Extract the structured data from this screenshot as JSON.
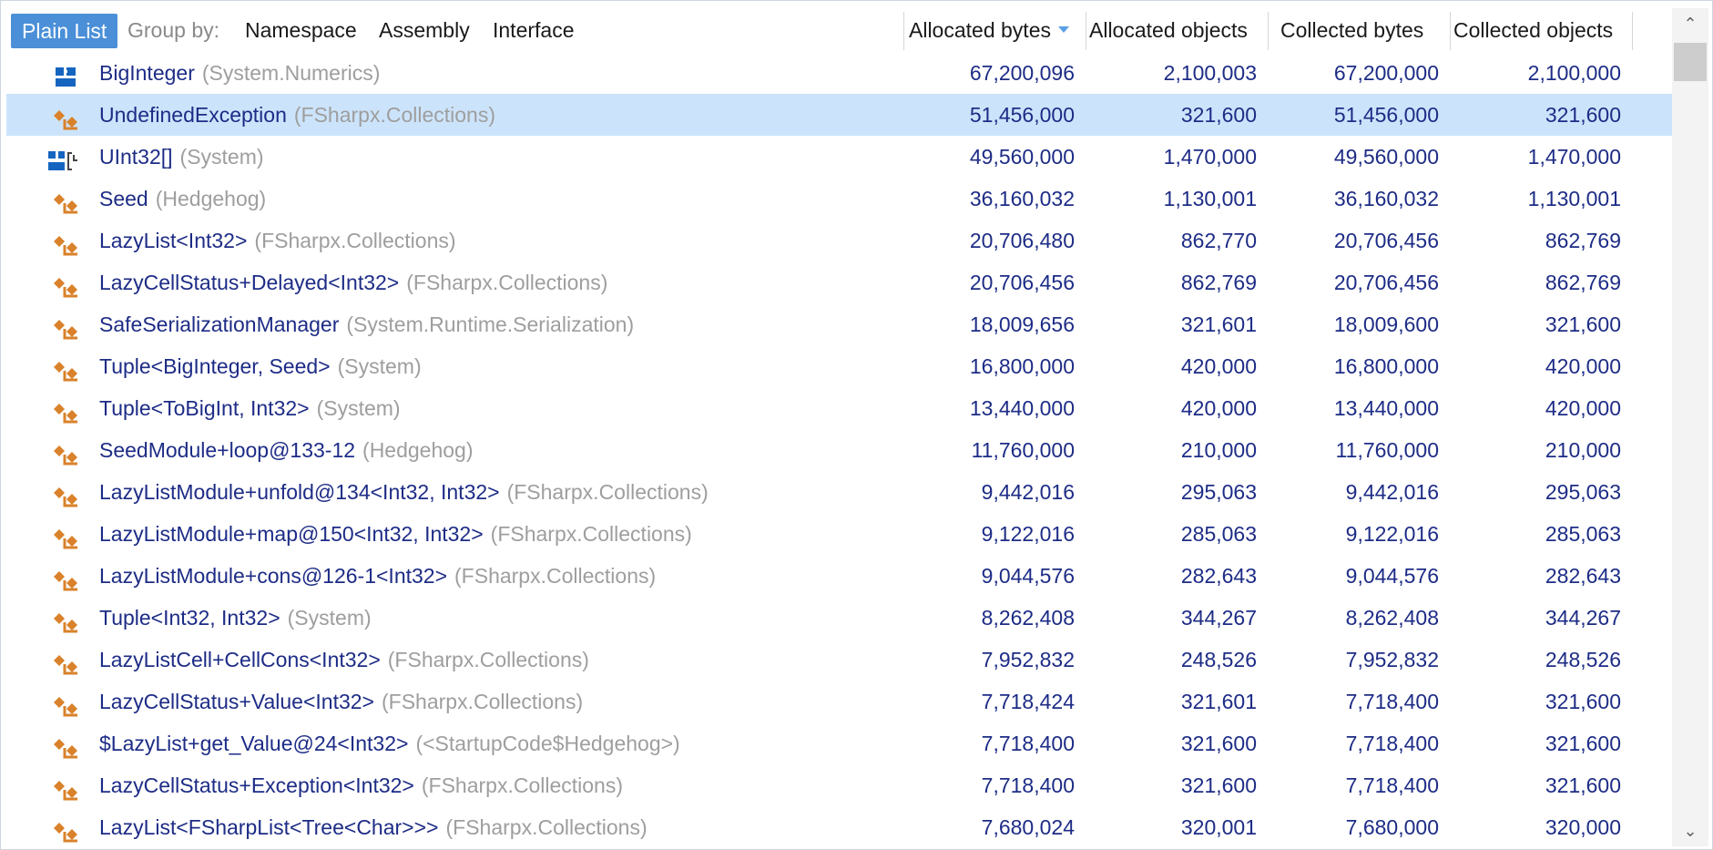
{
  "toolbar": {
    "plain_list": "Plain List",
    "group_by": "Group by:",
    "namespace": "Namespace",
    "assembly": "Assembly",
    "interface": "Interface"
  },
  "columns": {
    "allocated_bytes": "Allocated bytes",
    "allocated_objects": "Allocated objects",
    "collected_bytes": "Collected bytes",
    "collected_objects": "Collected objects"
  },
  "colors": {
    "accent": "#4a8fd8",
    "selection": "#cce4fb",
    "type_text": "#1d2c86",
    "ns_text": "#9e9e9e",
    "class_icon": "#d9822b",
    "struct_icon": "#1565c0"
  },
  "rows": [
    {
      "name": "BigInteger",
      "ns": "(System.Numerics)",
      "icon": "struct-icon",
      "ab": "67,200,096",
      "ao": "2,100,003",
      "cb": "67,200,000",
      "co": "2,100,000"
    },
    {
      "name": "UndefinedException",
      "ns": "(FSharpx.Collections)",
      "icon": "class-icon",
      "ab": "51,456,000",
      "ao": "321,600",
      "cb": "51,456,000",
      "co": "321,600"
    },
    {
      "name": "UInt32[]",
      "ns": "(System)",
      "icon": "array-icon",
      "ab": "49,560,000",
      "ao": "1,470,000",
      "cb": "49,560,000",
      "co": "1,470,000"
    },
    {
      "name": "Seed",
      "ns": "(Hedgehog)",
      "icon": "class-icon",
      "ab": "36,160,032",
      "ao": "1,130,001",
      "cb": "36,160,032",
      "co": "1,130,001"
    },
    {
      "name": "LazyList<Int32>",
      "ns": "(FSharpx.Collections)",
      "icon": "class-icon",
      "ab": "20,706,480",
      "ao": "862,770",
      "cb": "20,706,456",
      "co": "862,769"
    },
    {
      "name": "LazyCellStatus+Delayed<Int32>",
      "ns": "(FSharpx.Collections)",
      "icon": "class-icon",
      "ab": "20,706,456",
      "ao": "862,769",
      "cb": "20,706,456",
      "co": "862,769"
    },
    {
      "name": "SafeSerializationManager",
      "ns": "(System.Runtime.Serialization)",
      "icon": "class-icon",
      "ab": "18,009,656",
      "ao": "321,601",
      "cb": "18,009,600",
      "co": "321,600"
    },
    {
      "name": "Tuple<BigInteger, Seed>",
      "ns": "(System)",
      "icon": "class-icon",
      "ab": "16,800,000",
      "ao": "420,000",
      "cb": "16,800,000",
      "co": "420,000"
    },
    {
      "name": "Tuple<ToBigInt, Int32>",
      "ns": "(System)",
      "icon": "class-icon",
      "ab": "13,440,000",
      "ao": "420,000",
      "cb": "13,440,000",
      "co": "420,000"
    },
    {
      "name": "SeedModule+loop@133-12",
      "ns": "(Hedgehog)",
      "icon": "class-icon",
      "ab": "11,760,000",
      "ao": "210,000",
      "cb": "11,760,000",
      "co": "210,000"
    },
    {
      "name": "LazyListModule+unfold@134<Int32, Int32>",
      "ns": "(FSharpx.Collections)",
      "icon": "class-icon",
      "ab": "9,442,016",
      "ao": "295,063",
      "cb": "9,442,016",
      "co": "295,063"
    },
    {
      "name": "LazyListModule+map@150<Int32, Int32>",
      "ns": "(FSharpx.Collections)",
      "icon": "class-icon",
      "ab": "9,122,016",
      "ao": "285,063",
      "cb": "9,122,016",
      "co": "285,063"
    },
    {
      "name": "LazyListModule+cons@126-1<Int32>",
      "ns": "(FSharpx.Collections)",
      "icon": "class-icon",
      "ab": "9,044,576",
      "ao": "282,643",
      "cb": "9,044,576",
      "co": "282,643"
    },
    {
      "name": "Tuple<Int32, Int32>",
      "ns": "(System)",
      "icon": "class-icon",
      "ab": "8,262,408",
      "ao": "344,267",
      "cb": "8,262,408",
      "co": "344,267"
    },
    {
      "name": "LazyListCell+CellCons<Int32>",
      "ns": "(FSharpx.Collections)",
      "icon": "class-icon",
      "ab": "7,952,832",
      "ao": "248,526",
      "cb": "7,952,832",
      "co": "248,526"
    },
    {
      "name": "LazyCellStatus+Value<Int32>",
      "ns": "(FSharpx.Collections)",
      "icon": "class-icon",
      "ab": "7,718,424",
      "ao": "321,601",
      "cb": "7,718,400",
      "co": "321,600"
    },
    {
      "name": "$LazyList+get_Value@24<Int32>",
      "ns": "(<StartupCode$Hedgehog>)",
      "icon": "class-icon",
      "ab": "7,718,400",
      "ao": "321,600",
      "cb": "7,718,400",
      "co": "321,600"
    },
    {
      "name": "LazyCellStatus+Exception<Int32>",
      "ns": "(FSharpx.Collections)",
      "icon": "class-icon",
      "ab": "7,718,400",
      "ao": "321,600",
      "cb": "7,718,400",
      "co": "321,600"
    },
    {
      "name": "LazyList<FSharpList<Tree<Char>>>",
      "ns": "(FSharpx.Collections)",
      "icon": "class-icon",
      "ab": "7,680,024",
      "ao": "320,001",
      "cb": "7,680,000",
      "co": "320,000"
    }
  ]
}
